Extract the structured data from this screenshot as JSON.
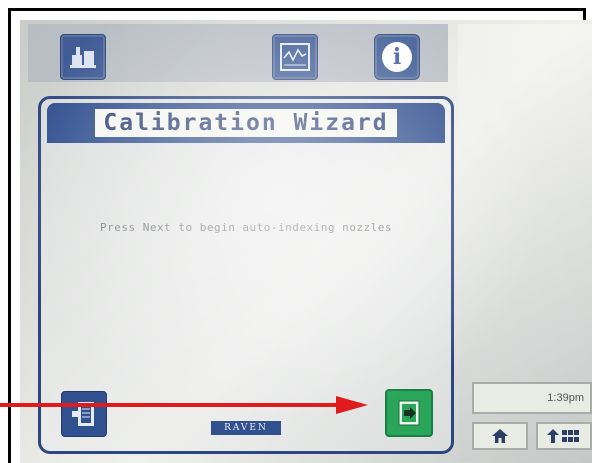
{
  "wizard": {
    "title": "Calibration Wizard",
    "message": "Press Next to begin auto-indexing nozzles",
    "logo": "RAVEN"
  },
  "status": {
    "time": "1:39pm"
  },
  "icons": {
    "toolbar_left": "implement-icon",
    "toolbar_middle": "graph-icon",
    "toolbar_info": "info-icon",
    "back": "back-page-icon",
    "next": "next-page-icon",
    "home": "home-icon",
    "up": "up-grid-icon"
  },
  "colors": {
    "accent_blue": "#31508f",
    "next_green": "#29a65a",
    "annotation_red": "#e01b1b"
  }
}
